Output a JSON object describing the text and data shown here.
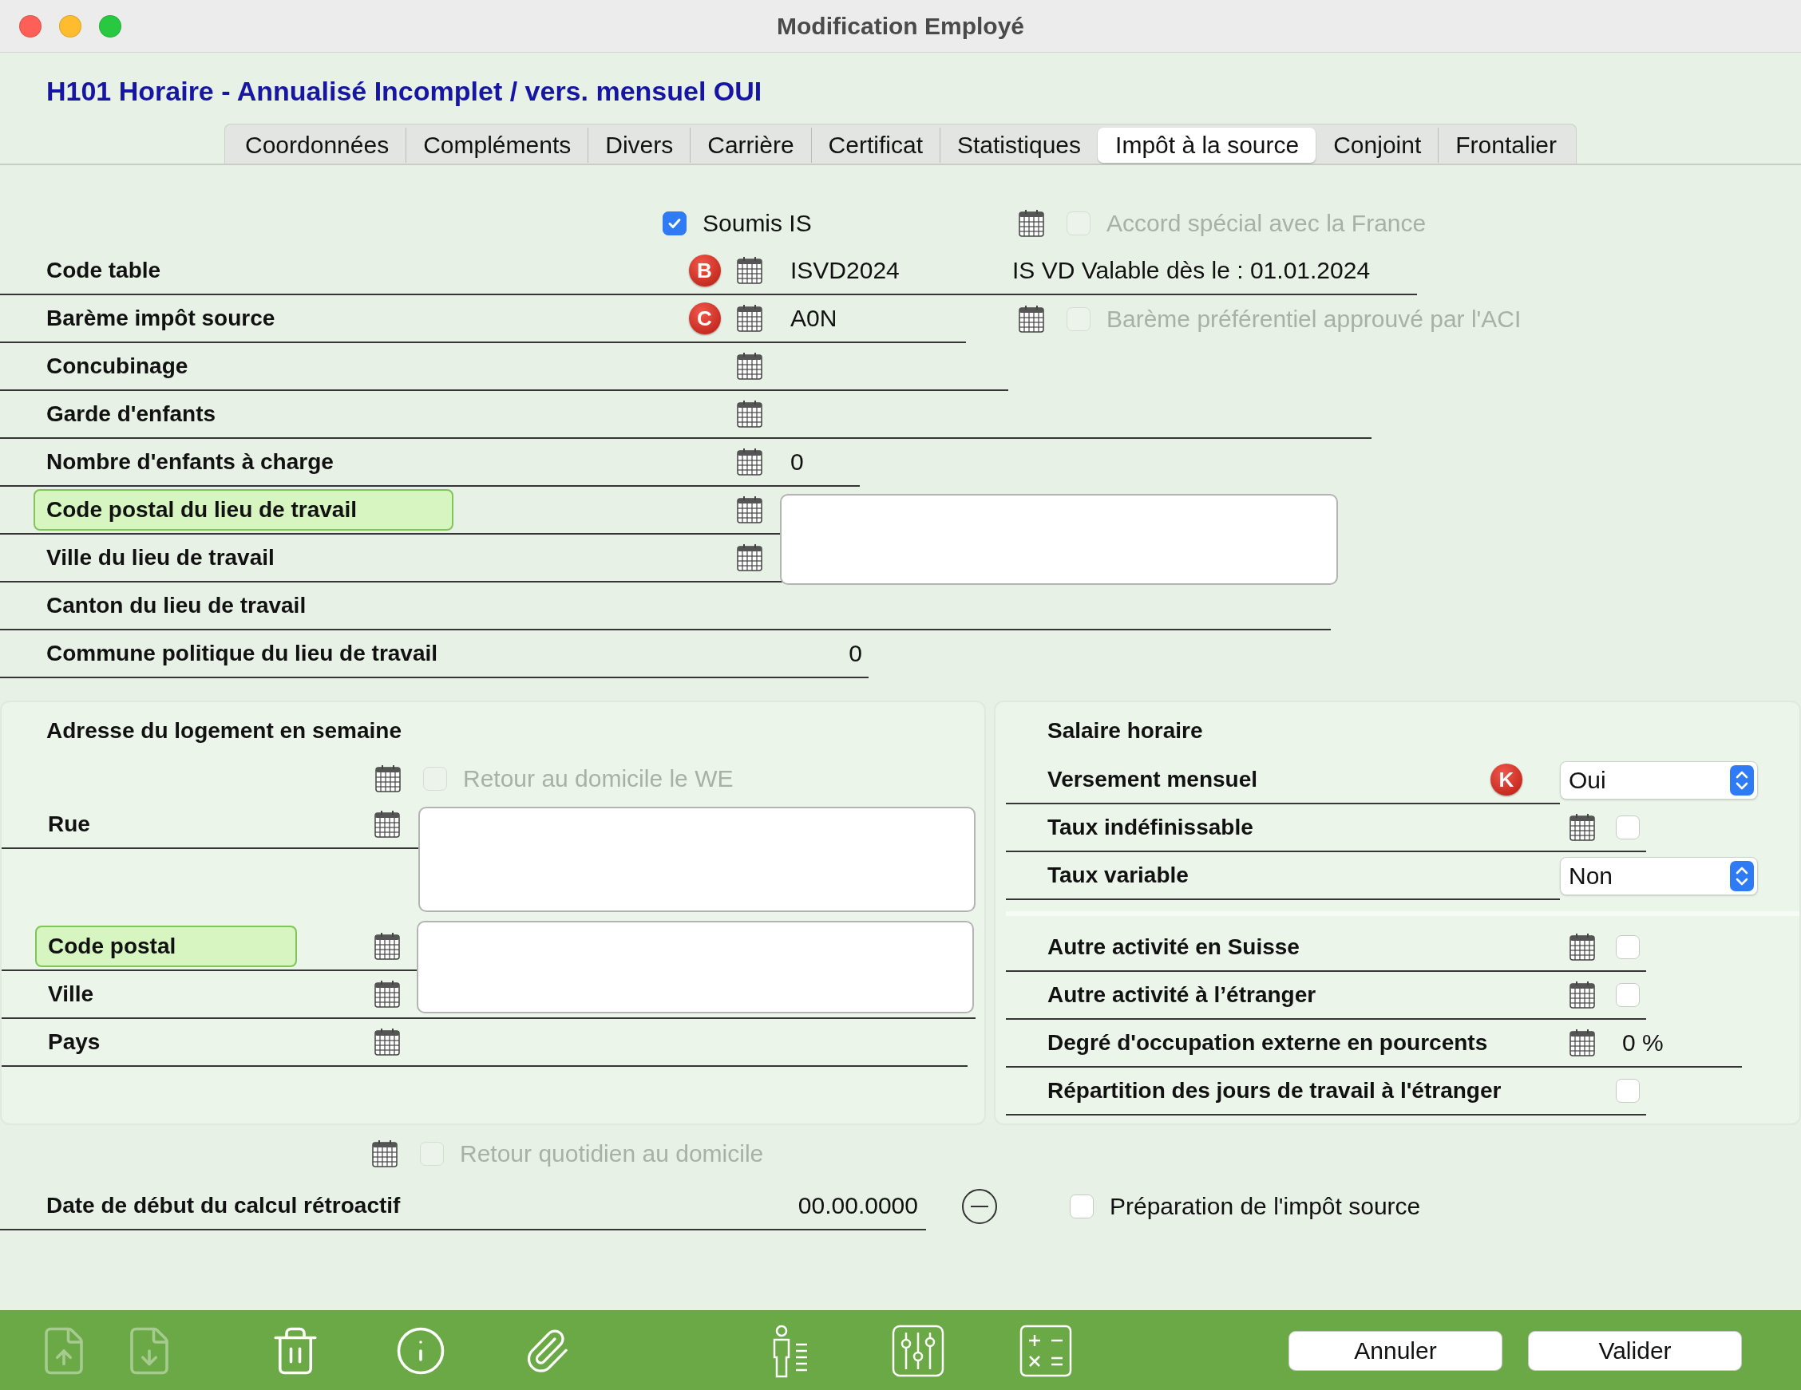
{
  "window": {
    "title": "Modification Employé"
  },
  "header": "H101 Horaire - Annualisé Incomplet / vers. mensuel OUI",
  "tabs": [
    {
      "label": "Coordonnées",
      "selected": false
    },
    {
      "label": "Compléments",
      "selected": false
    },
    {
      "label": "Divers",
      "selected": false
    },
    {
      "label": "Carrière",
      "selected": false
    },
    {
      "label": "Certificat",
      "selected": false
    },
    {
      "label": "Statistiques",
      "selected": false
    },
    {
      "label": "Impôt à la source",
      "selected": true
    },
    {
      "label": "Conjoint",
      "selected": false
    },
    {
      "label": "Frontalier",
      "selected": false
    }
  ],
  "options": [
    {
      "label": "Soumis IS",
      "checked": true,
      "disabled": false
    },
    {
      "label": "Accord spécial avec la France",
      "checked": false,
      "disabled": true
    }
  ],
  "tax_rows": [
    {
      "label": "Code table",
      "highlighted": false,
      "badge": "B",
      "value": "ISVD2024",
      "note": "IS VD Valable dès le : 01.01.2024"
    },
    {
      "label": "Barème impôt source",
      "highlighted": false,
      "badge": "C",
      "value": "A0N",
      "option": {
        "label": "Barème préférentiel approuvé par l'ACI",
        "checked": false,
        "disabled": true
      }
    },
    {
      "label": "Concubinage",
      "highlighted": false
    },
    {
      "label": "Garde d'enfants",
      "highlighted": false
    },
    {
      "label": "Nombre d'enfants à charge",
      "highlighted": false,
      "value": "0"
    },
    {
      "label": "Code postal du lieu de travail",
      "highlighted": true
    },
    {
      "label": "Ville du lieu de travail",
      "highlighted": false
    },
    {
      "label": "Canton du lieu de travail",
      "highlighted": false
    },
    {
      "label": "Commune politique du lieu de travail",
      "highlighted": false,
      "value": "0"
    }
  ],
  "address": {
    "title": "Adresse du logement en semaine",
    "weekend_return": {
      "label": "Retour au domicile le WE",
      "checked": false,
      "disabled": true
    },
    "rows": [
      {
        "label": "Rue",
        "highlighted": false
      },
      {
        "label": "Code postal",
        "highlighted": true
      },
      {
        "label": "Ville",
        "highlighted": false
      },
      {
        "label": "Pays",
        "highlighted": false
      }
    ]
  },
  "salary": {
    "title": "Salaire horaire",
    "rows": [
      {
        "kind": "select",
        "label": "Versement mensuel",
        "badge": "K",
        "value": "Oui"
      },
      {
        "kind": "checkbox",
        "label": "Taux indéfinissable",
        "checked": false
      },
      {
        "kind": "select",
        "label": "Taux variable",
        "value": "Non"
      }
    ]
  },
  "activity_rows": [
    {
      "kind": "checkbox",
      "label": "Autre activité en Suisse",
      "checked": false
    },
    {
      "kind": "checkbox",
      "label": "Autre activité à l’étranger",
      "checked": false
    },
    {
      "kind": "value",
      "label": "Degré d'occupation externe en pourcents",
      "value": "0 %"
    },
    {
      "kind": "checkbox",
      "label": "Répartition des jours de travail à l'étranger",
      "checked": false
    }
  ],
  "daily_return": {
    "label": "Retour quotidien au domicile",
    "checked": false,
    "disabled": true
  },
  "retro": {
    "label": "Date de début du calcul rétroactif",
    "value": "00.00.0000"
  },
  "preparation": {
    "label": "Préparation de l'impôt source",
    "checked": false,
    "disabled": false
  },
  "toolbar": {
    "tools": [
      {
        "kind": "upload",
        "disabled": true
      },
      {
        "kind": "download",
        "disabled": true
      },
      {
        "kind": "trash",
        "disabled": false
      },
      {
        "kind": "info",
        "disabled": false
      },
      {
        "kind": "attach",
        "disabled": false
      },
      {
        "kind": "person-list",
        "disabled": false
      },
      {
        "kind": "sliders",
        "disabled": false
      },
      {
        "kind": "calculator",
        "disabled": false
      }
    ],
    "buttons": [
      "Annuler",
      "Valider"
    ]
  }
}
